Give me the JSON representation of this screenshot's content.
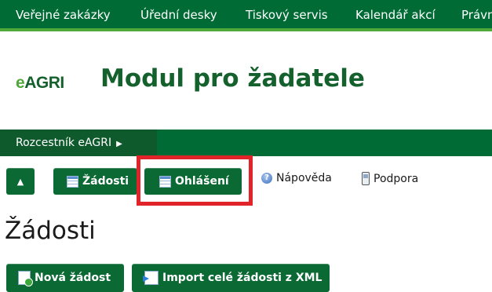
{
  "top_nav": {
    "items": [
      "Veřejné zakázky",
      "Úřední desky",
      "Tiskový servis",
      "Kalendář akcí",
      "Právn"
    ]
  },
  "logo": {
    "text_e": "e",
    "text_rest": "AGRI"
  },
  "module_title": "Modul pro žadatele",
  "breadcrumb": {
    "label": "Rozcestník eAGRI",
    "arrow": "▶"
  },
  "toolbar": {
    "up_arrow": "▲",
    "zadosti_label": "Žádosti",
    "ohlaseni_label": "Ohlášení",
    "help_label": "Nápověda",
    "support_label": "Podpora"
  },
  "page_heading": "Žádosti",
  "actions": {
    "new_request_label": "Nová žádost",
    "import_label": "Import celé žádosti z XML"
  },
  "colors": {
    "nav_green": "#006b35",
    "accent_green": "#4fa83a",
    "highlight_red": "#e0242a"
  }
}
